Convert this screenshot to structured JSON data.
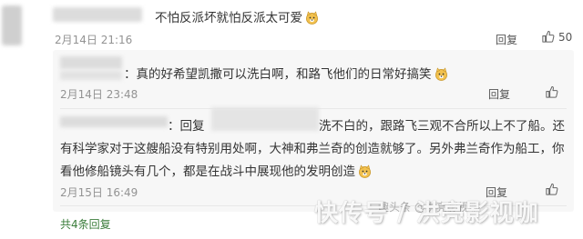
{
  "comment": {
    "text": "不怕反派坏就怕反派太可爱",
    "date": "2月14日 21:16",
    "reply_label": "回复",
    "likes": "50"
  },
  "replies": [
    {
      "text": "：真的好希望凯撒可以洗白啊，和路飞他们的日常好搞笑",
      "date": "2月14日 23:48",
      "reply_label": "回复"
    },
    {
      "line1_a": "：回复",
      "line1_b": "洗不白的，跟路飞三观不合所以上不了船。还",
      "line2": "有科学家对于这艘船没有特别用处啊，大神和弗兰奇的创造就够了。另外弗兰奇作为船工，你",
      "line3": "看他修船镜头有几个，都是在战斗中展现他的发明创造",
      "date": "2月15日 16:49",
      "reply_label": "回复"
    }
  ],
  "total_replies": "共4条回复",
  "watermark": "快传号 / 洪亮影视咖",
  "watermark_small": "趣头条 @洪亮影视咖"
}
